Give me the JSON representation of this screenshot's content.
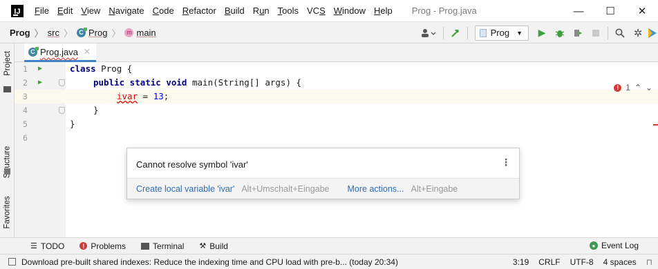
{
  "window": {
    "title": "Prog - Prog.java",
    "app_icon": "intellij-logo"
  },
  "menu": [
    {
      "label": "File",
      "mnemonic": "F",
      "rest": "ile"
    },
    {
      "label": "Edit",
      "mnemonic": "E",
      "rest": "dit"
    },
    {
      "label": "View",
      "mnemonic": "V",
      "rest": "iew"
    },
    {
      "label": "Navigate",
      "mnemonic": "N",
      "rest": "avigate"
    },
    {
      "label": "Code",
      "mnemonic": "C",
      "rest": "ode"
    },
    {
      "label": "Refactor",
      "mnemonic": "R",
      "rest": "efactor"
    },
    {
      "label": "Build",
      "mnemonic": "B",
      "rest": "uild"
    },
    {
      "label": "Run",
      "pre": "R",
      "mnemonic": "u",
      "rest": "n"
    },
    {
      "label": "Tools",
      "mnemonic": "T",
      "rest": "ools"
    },
    {
      "label": "VCS",
      "pre": "VC",
      "mnemonic": "S",
      "rest": ""
    },
    {
      "label": "Window",
      "mnemonic": "W",
      "rest": "indow"
    },
    {
      "label": "Help",
      "mnemonic": "H",
      "rest": "elp"
    }
  ],
  "window_controls": {
    "minimize": "—",
    "maximize": "☐",
    "close": "✕"
  },
  "breadcrumb": {
    "project": "Prog",
    "src": "src",
    "class": "Prog",
    "class_icon_letter": "C",
    "method": "main",
    "method_icon_letter": "m"
  },
  "toolbar": {
    "run_config": "Prog"
  },
  "side_tabs": {
    "project": "Project",
    "structure": "Structure",
    "favorites": "Favorites"
  },
  "editor_tab": {
    "file": "Prog.java"
  },
  "code_lines": [
    {
      "num": "1",
      "run": true,
      "fold": false
    },
    {
      "num": "2",
      "run": true,
      "fold": true
    },
    {
      "num": "3",
      "run": false,
      "fold": false
    },
    {
      "num": "4",
      "run": false,
      "fold": true
    },
    {
      "num": "5",
      "run": false,
      "fold": false
    },
    {
      "num": "6",
      "run": false,
      "fold": false
    }
  ],
  "code": {
    "l1_kw": "class",
    "l1_rest": " Prog {",
    "l2_kw": "public static void",
    "l2_rest": " main(String[] args) {",
    "l3_ident": "ivar",
    "l3_op": " = ",
    "l3_num": "13",
    "l3_end": ";",
    "l4": "}",
    "l5": "}"
  },
  "inspection": {
    "error_count": "1"
  },
  "popup": {
    "message": "Cannot resolve symbol 'ivar'",
    "fix_label": "Create local variable 'ivar'",
    "fix_shortcut": "Alt+Umschalt+Eingabe",
    "more_label": "More actions...",
    "more_shortcut": "Alt+Eingabe"
  },
  "tool_windows": {
    "todo": "TODO",
    "problems": "Problems",
    "terminal": "Terminal",
    "build": "Build",
    "event_log": "Event Log"
  },
  "status": {
    "message": "Download pre-built shared indexes: Reduce the indexing time and CPU load with pre-b... (today 20:34)",
    "position": "3:19",
    "line_sep": "CRLF",
    "encoding": "UTF-8",
    "indent": "4 spaces"
  }
}
